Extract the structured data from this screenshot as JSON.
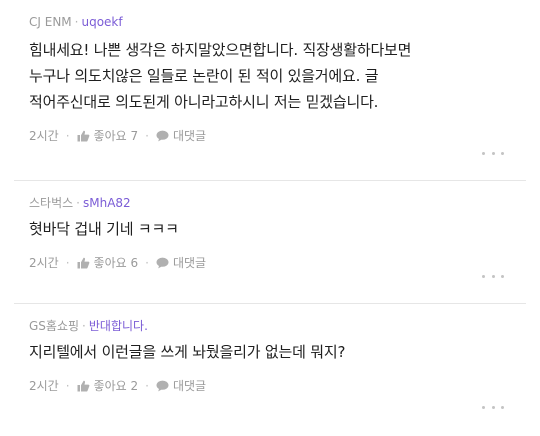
{
  "comments": [
    {
      "author": "CJ ENM",
      "username": "uqoekf",
      "body": "힘내세요! 나쁜 생각은 하지말았으면합니다. 직장생활하다보면\n누구나 의도치않은 일들로 논란이 된 적이 있을거에요. 글\n적어주신대로 의도된게 아니라고하시니  저는 믿겠습니다.",
      "time": "2시간",
      "like_label": "좋아요 7",
      "reply_label": "대댓글"
    },
    {
      "author": "스타벅스",
      "username": "sMhA82",
      "body": "혓바닥 겁내 기네 ㅋㅋㅋ",
      "time": "2시간",
      "like_label": "좋아요 6",
      "reply_label": "대댓글"
    },
    {
      "author": "GS홈쇼핑",
      "username": "반대합니다.",
      "body": "지리텔에서 이런글을 쓰게 놔뒀을리가 없는데 뭐지?",
      "time": "2시간",
      "like_label": "좋아요 2",
      "reply_label": "대댓글"
    }
  ],
  "separators": {
    "meta": "·",
    "action": "·"
  },
  "colors": {
    "username": "#7b5cd6",
    "meta_text": "#9a9a9a",
    "body_text": "#1f1f1f",
    "divider": "#e6e6e6",
    "icon": "#b0b0b0"
  },
  "icons": {
    "like": "thumbs-up-icon",
    "reply": "speech-bubble-icon",
    "more": "more-dots-icon"
  }
}
